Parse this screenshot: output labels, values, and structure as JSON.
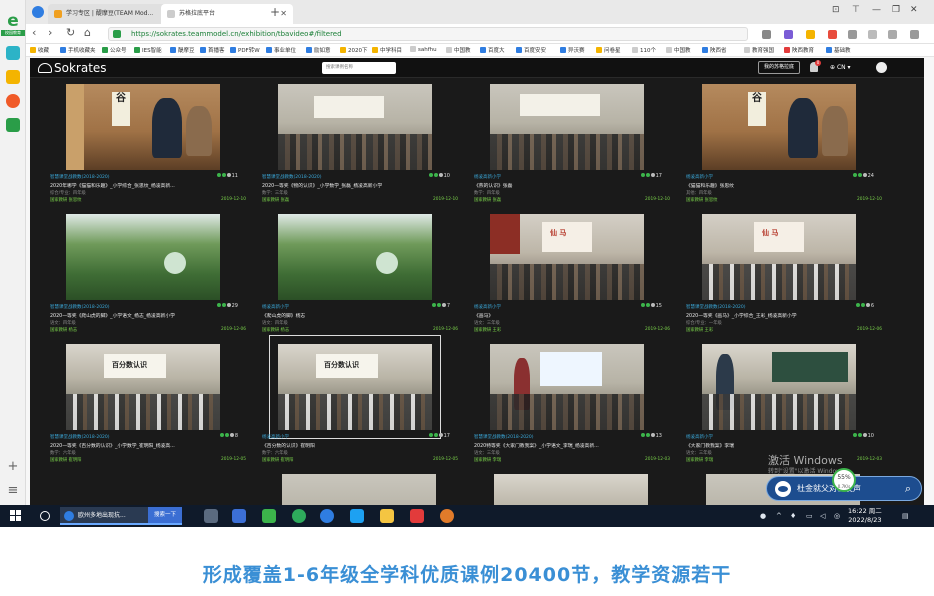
{
  "browser": {
    "tabs": [
      {
        "label": "学习专区 | 醍摩豆(TEAM Mod..."
      },
      {
        "label": "苏格拉底平台"
      }
    ],
    "url": "https://sokrates.teammodel.cn/exhibition/tbavideo#/filtered",
    "bookmarks": [
      "收藏",
      "手机收藏夹",
      "公众号",
      "IES智能",
      "醍摩豆",
      "首播客",
      "PDF转W",
      "事业单位",
      "励如意",
      "2020下",
      "中学科目",
      "sahfhu",
      "中国教",
      "百度大",
      "百度安安",
      "异沃赛",
      "问卷星",
      "110个",
      "中国教",
      "陕西省",
      "教育强国",
      "陕西教育",
      "基础教"
    ]
  },
  "sidebar": {
    "logo_text": "e",
    "logo_caption": "校园教育"
  },
  "site": {
    "logo": "Sokrates",
    "search_placeholder": "搜索课例名称",
    "my_platform": "我的苏格拉底",
    "notif_count": "0",
    "lang": "CN"
  },
  "cards": [
    {
      "school": "智慧课堂战教数(2018-2020)",
      "views": "11",
      "title": "2020年哪学《猫猫和乐趣》_小学综合_张思纹_杨凌高新...",
      "subject": "综合/专业：四年级",
      "tags": "国家教研  张思纹",
      "date": "2019-12-10"
    },
    {
      "school": "智慧课堂战教数(2018-2020)",
      "views": "10",
      "title": "2020一等奖《物的认识》_小学数学_张磊_杨凌高新小学",
      "subject": "数学：三年级",
      "tags": "国家教研  张磊",
      "date": "2019-12-10"
    },
    {
      "school": "杨凌高新小学",
      "views": "17",
      "title": "《燕的认识》张磊",
      "subject": "数学：四年级",
      "tags": "国家教研  张磊",
      "date": "2019-12-10"
    },
    {
      "school": "杨凌高新小学",
      "views": "24",
      "title": "《猫猫和乐趣》张思纹",
      "subject": "其他：四年级",
      "tags": "国家教研  张思纹",
      "date": "2019-12-10"
    },
    {
      "school": "智慧课堂战教数(2018-2020)",
      "views": "29",
      "title": "2020一等奖《爬山虎的脚》_小学语文_杨志_杨凌高新小学",
      "subject": "语文：四年级",
      "tags": "国家教研  杨志",
      "date": "2019-12-06"
    },
    {
      "school": "杨凌高新小学",
      "views": "7",
      "title": "《爬山虎的脚》杨志",
      "subject": "语文：四年级",
      "tags": "国家教研  杨志",
      "date": "2019-12-06"
    },
    {
      "school": "杨凌高新小学",
      "views": "15",
      "title": "《画马》",
      "subject": "语文：三年级",
      "tags": "国家教研  王彩",
      "date": "2019-12-06"
    },
    {
      "school": "智慧课堂战教数(2018-2020)",
      "views": "6",
      "title": "2020一等奖《画马》_小学综合_王彩_杨凌高新小学",
      "subject": "综合/专业：一年级",
      "tags": "国家教研  王彩",
      "date": "2019-12-06"
    },
    {
      "school": "智慧课堂战教数(2018-2020)",
      "views": "8",
      "title": "2020一等奖《百分数的认识》_小学数学_崔明阳_杨凌高...",
      "subject": "数学：六年级",
      "tags": "国家教研  崔明阳",
      "date": "2019-12-05"
    },
    {
      "school": "杨凌高新小学",
      "views": "17",
      "title": "《百分数的认识》崔明阳",
      "subject": "数学：六年级",
      "tags": "国家教研  崔明阳",
      "date": "2019-12-05"
    },
    {
      "school": "智慧课堂战教数(2018-2020)",
      "views": "13",
      "title": "2020特等奖《大家门教我案》_小学语文_李瑞_杨凌高新...",
      "subject": "语文：三年级",
      "tags": "国家教研  李瑞",
      "date": "2019-12-03"
    },
    {
      "school": "杨凌高新小学",
      "views": "10",
      "title": "《大家门教我案》李瑞",
      "subject": "语文：三年级",
      "tags": "国家教研  李瑞",
      "date": "2019-12-03"
    }
  ],
  "overlay": {
    "activate_title": "激活 Windows",
    "activate_sub": "转到\"设置\"以激活 Windows。",
    "pill_text": "杜金就父对程发声",
    "gauge_pct": "55%",
    "gauge_speed": "0.7K/s"
  },
  "taskbar": {
    "task_text": "欧州多地出现抗...",
    "task_search": "搜索一下",
    "time": "16:22 周二",
    "date": "2022/8/23"
  },
  "caption": "形成覆盖1-6年级全学科优质课例20400节，教学资源若干"
}
